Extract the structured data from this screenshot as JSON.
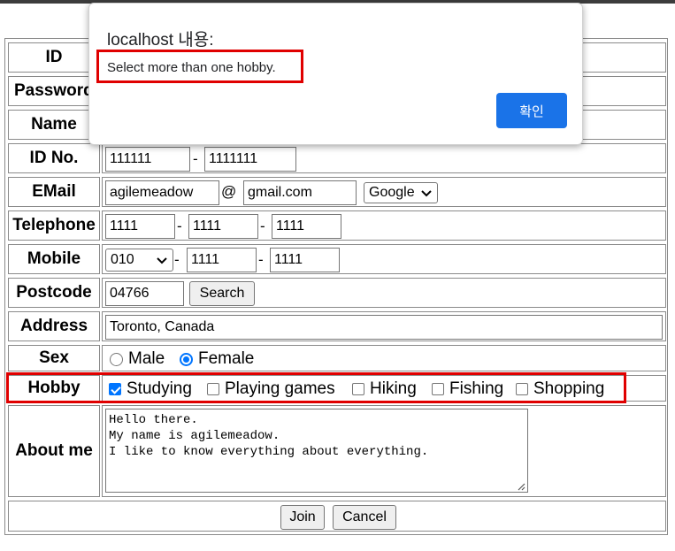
{
  "dialog": {
    "title": "localhost 내용:",
    "message": "Select more than one hobby.",
    "ok_label": "확인"
  },
  "form": {
    "id": {
      "label": "ID"
    },
    "password": {
      "label": "Password"
    },
    "name": {
      "label": "Name"
    },
    "id_no": {
      "label": "ID No.",
      "first": "111111",
      "separator": "-",
      "second": "1111111"
    },
    "email": {
      "label": "EMail",
      "user": "agilemeadow",
      "at": "@",
      "domain": "gmail.com",
      "provider_selected": "Google"
    },
    "telephone": {
      "label": "Telephone",
      "part1": "1111",
      "part2": "1111",
      "part3": "1111",
      "separator": "-"
    },
    "mobile": {
      "label": "Mobile",
      "prefix_selected": "010",
      "part2": "1111",
      "part3": "1111",
      "separator": "-"
    },
    "postcode": {
      "label": "Postcode",
      "value": "04766",
      "search_label": "Search"
    },
    "address": {
      "label": "Address",
      "value": "Toronto, Canada"
    },
    "sex": {
      "label": "Sex",
      "options": [
        {
          "label": "Male",
          "checked": false
        },
        {
          "label": "Female",
          "checked": true
        }
      ]
    },
    "hobby": {
      "label": "Hobby",
      "options": [
        {
          "label": "Studying",
          "checked": true
        },
        {
          "label": "Playing games",
          "checked": false
        },
        {
          "label": "Hiking",
          "checked": false
        },
        {
          "label": "Fishing",
          "checked": false
        },
        {
          "label": "Shopping",
          "checked": false
        }
      ]
    },
    "about": {
      "label": "About me",
      "value": "Hello there.\nMy name is agilemeadow.\nI like to know everything about everything."
    },
    "join_label": "Join",
    "cancel_label": "Cancel"
  },
  "colors": {
    "accent": "#0075ff",
    "dialog_button": "#1a73e8",
    "highlight": "#e00000"
  }
}
